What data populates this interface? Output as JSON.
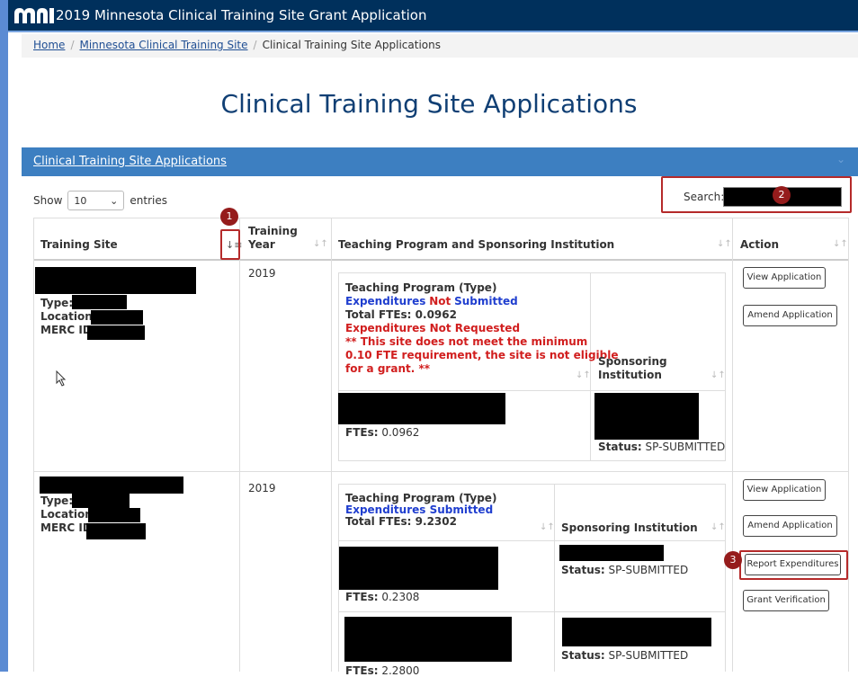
{
  "header": {
    "title": "2019 Minnesota Clinical Training Site Grant Application"
  },
  "breadcrumb": {
    "home": "Home",
    "parent": "Minnesota Clinical Training Site",
    "current": "Clinical Training Site Applications"
  },
  "page_title": "Clinical Training Site Applications",
  "panel": {
    "title": "Clinical Training Site Applications"
  },
  "controls": {
    "show_label": "Show",
    "entries_value": "10",
    "entries_label": "entries",
    "search_label": "Search:"
  },
  "table": {
    "columns": [
      "Training Site",
      "Training Year",
      "Teaching Program and Sponsoring Institution",
      "Action"
    ]
  },
  "labels": {
    "type": "Type:",
    "location": "Location:",
    "merc_id": "MERC ID:"
  },
  "rows": [
    {
      "year": "2019",
      "tp_header": "Teaching Program (Type)",
      "exp_line": {
        "a": "Expenditures",
        "b": "Not",
        "c": "Submitted"
      },
      "total_ftes": "Total FTEs: 0.0962",
      "warning": [
        "Expenditures Not Requested",
        "** This site does not meet the minimum",
        "0.10 FTE requirement, the site is not eligible",
        "for a grant. **"
      ],
      "si_header_lines": [
        "Sponsoring",
        "Institution"
      ],
      "programs": [
        {
          "ftes_label": "FTEs:",
          "ftes": "0.0962"
        }
      ],
      "sponsor_statuses": [
        {
          "label": "Status:",
          "value": "SP-SUBMITTED"
        }
      ],
      "actions": [
        "View Application",
        "Amend Application"
      ]
    },
    {
      "year": "2019",
      "tp_header": "Teaching Program (Type)",
      "exp_line": "Expenditures Submitted",
      "total_ftes": "Total FTEs: 9.2302",
      "si_header": "Sponsoring Institution",
      "programs": [
        {
          "ftes_label": "FTEs:",
          "ftes": "0.2308"
        },
        {
          "ftes_label": "FTEs:",
          "ftes": "2.2800"
        }
      ],
      "sponsor_statuses": [
        {
          "label": "Status:",
          "value": "SP-SUBMITTED"
        },
        {
          "label": "Status:",
          "value": "SP-SUBMITTED"
        }
      ],
      "actions": [
        "View Application",
        "Amend Application",
        "Report Expenditures",
        "Grant Verification"
      ]
    }
  ],
  "markers": [
    "1",
    "2",
    "3"
  ],
  "colors": {
    "header": "#00305c",
    "panel": "#3d7fc1",
    "annotation": "#b52a2a",
    "title": "#103f74"
  }
}
